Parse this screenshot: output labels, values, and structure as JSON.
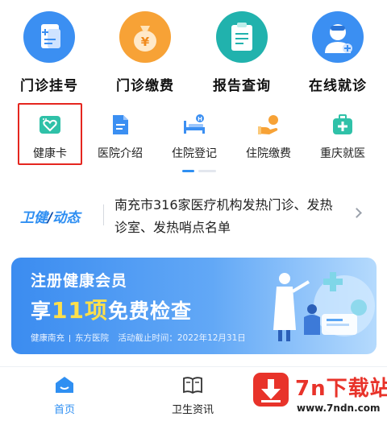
{
  "main_services": [
    {
      "label": "门诊挂号",
      "icon": "registration-card-icon",
      "color": "#3b8ff2"
    },
    {
      "label": "门诊缴费",
      "icon": "money-bag-icon",
      "color": "#f7a236"
    },
    {
      "label": "报告查询",
      "icon": "clipboard-report-icon",
      "color": "#21b2ad"
    },
    {
      "label": "在线就诊",
      "icon": "doctor-icon",
      "color": "#3b8ff2"
    }
  ],
  "quick_services": [
    {
      "label": "健康卡",
      "icon": "health-card-icon",
      "color": "#2fc1a8",
      "highlighted": true
    },
    {
      "label": "医院介绍",
      "icon": "document-icon",
      "color": "#3b8ff2"
    },
    {
      "label": "住院登记",
      "icon": "hospital-bed-icon",
      "color": "#3b8ff2"
    },
    {
      "label": "住院缴费",
      "icon": "payment-hand-icon",
      "color": "#f7a236"
    },
    {
      "label": "重庆就医",
      "icon": "medical-kit-icon",
      "color": "#2fc1a8"
    }
  ],
  "news": {
    "brand_part1": "卫健",
    "brand_slash": "/",
    "brand_part2": "动态",
    "headline": "南充市316家医疗机构发热门诊、发热诊室、发热哨点名单"
  },
  "banner": {
    "title": "注册健康会员",
    "headline_prefix": "享",
    "headline_number": "11项",
    "headline_suffix": "免费检查",
    "footer_org1": "健康南充",
    "footer_org2": "东方医院",
    "footer_deadline": "活动截止时间：2022年12月31日"
  },
  "tabbar": [
    {
      "label": "首页",
      "icon": "home-icon",
      "active": true
    },
    {
      "label": "卫生资讯",
      "icon": "book-icon",
      "active": false
    }
  ],
  "watermark": {
    "title": "7n下载站",
    "url": "www.7ndn.com"
  },
  "colors": {
    "accent": "#2f8ff2",
    "highlight_border": "#e5261f",
    "watermark_red": "#e8332a"
  }
}
